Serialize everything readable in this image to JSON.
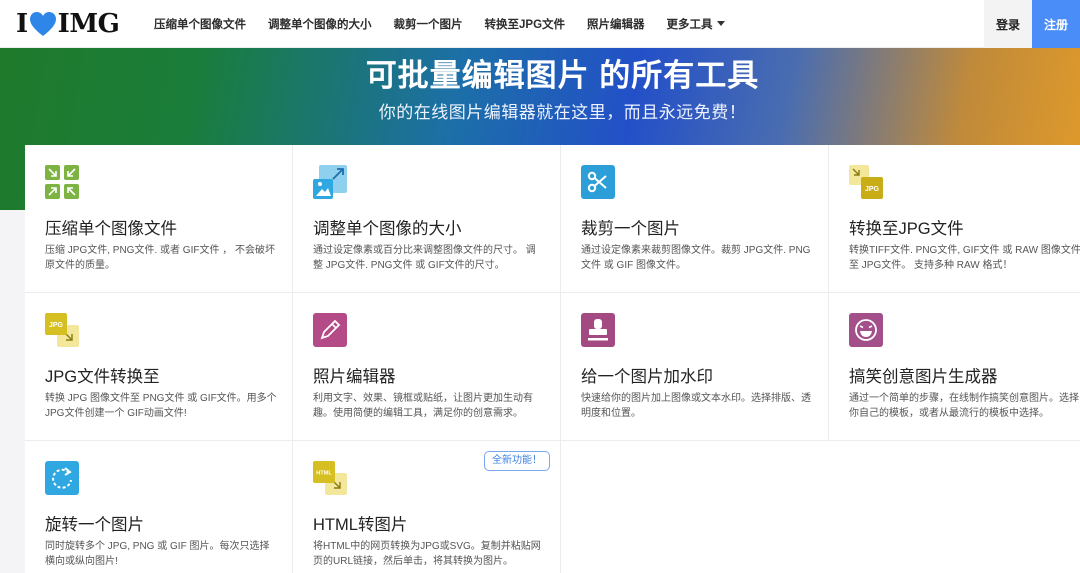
{
  "header": {
    "logo": {
      "left": "I",
      "right": "IMG"
    },
    "nav": [
      "压缩单个图像文件",
      "调整单个图像的大小",
      "裁剪一个图片",
      "转换至JPG文件",
      "照片编辑器",
      "更多工具"
    ],
    "login": "登录",
    "signup": "注册"
  },
  "hero": {
    "title": "可批量编辑图片 的所有工具",
    "subtitle": "你的在线图片编辑器就在这里，而且永远免费！"
  },
  "tools": [
    {
      "title": "压缩单个图像文件",
      "desc": "压缩 JPG文件, PNG文件. 或者 GIF文件 ， 不会破坏原文件的质量。",
      "icon": "compress-icon"
    },
    {
      "title": "调整单个图像的大小",
      "desc": "通过设定像素或百分比来调整图像文件的尺寸。 调整 JPG文件. PNG文件 或 GIF文件的尺寸。",
      "icon": "resize-icon"
    },
    {
      "title": "裁剪一个图片",
      "desc": "通过设定像素来裁剪图像文件。裁剪 JPG文件. PNG文件 或 GIF 图像文件。",
      "icon": "crop-icon"
    },
    {
      "title": "转换至JPG文件",
      "desc": "转换TIFF文件. PNG文件, GIF文件 或 RAW 图像文件至 JPG文件。 支持多种 RAW 格式！",
      "icon": "convert-to-jpg-icon",
      "icon_text": "JPG"
    },
    {
      "title": "JPG文件转换至",
      "desc": "转换 JPG 图像文件至 PNG文件 或 GIF文件。用多个JPG文件创建一个 GIF动画文件!",
      "icon": "convert-from-jpg-icon",
      "icon_text": "JPG"
    },
    {
      "title": "照片编辑器",
      "desc": "利用文字、效果、镜框或贴纸，让图片更加生动有趣。使用简便的编辑工具，满足你的创意需求。",
      "icon": "pencil-icon"
    },
    {
      "title": "给一个图片加水印",
      "desc": "快速给你的图片加上图像或文本水印。选择排版、透明度和位置。",
      "icon": "stamp-icon"
    },
    {
      "title": "搞笑创意图片生成器",
      "desc": "通过一个简单的步骤，在线制作搞笑创意图片。选择你自己的模板，或者从最流行的模板中选择。",
      "icon": "laugh-face-icon"
    },
    {
      "title": "旋转一个图片",
      "desc": "同时旋转多个 JPG, PNG 或 GIF 图片。每次只选择横向或纵向图片!",
      "icon": "rotate-icon"
    },
    {
      "title": "HTML转图片",
      "desc": "将HTML中的网页转换为JPG或SVG。复制并粘贴网页的URL链接，然后单击，将其转换为图片。",
      "icon": "html-to-image-icon",
      "icon_text": "HTML",
      "badge": "全新功能！"
    }
  ],
  "colors": {
    "compress": "#7cb342",
    "resize": "#2fa7e0",
    "crop": "#2d9fd8",
    "jpg": "#d8c02a",
    "pencil": "#b44a86",
    "stamp": "#a44a82",
    "laugh": "#a24f8a",
    "rotate": "#2fa7e0",
    "signup": "#4b8df8"
  }
}
